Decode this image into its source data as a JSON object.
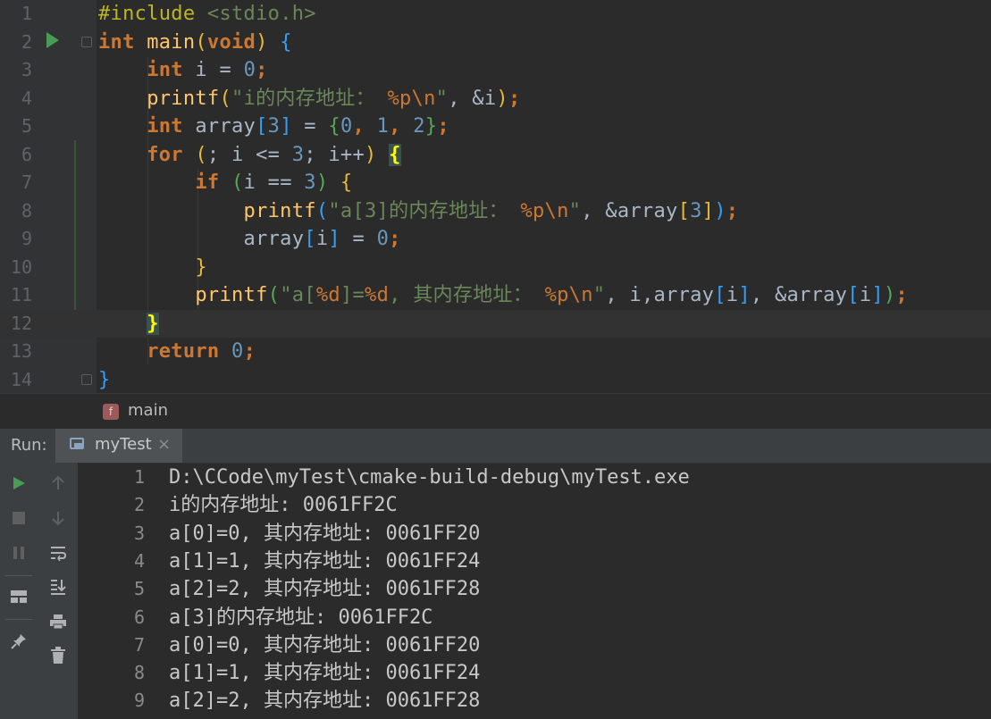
{
  "editor": {
    "line_numbers": [
      "1",
      "2",
      "3",
      "4",
      "5",
      "6",
      "7",
      "8",
      "9",
      "10",
      "11",
      "12",
      "13",
      "14"
    ],
    "l1": {
      "pp": "#include",
      "inc": " <stdio.h>"
    },
    "l2": {
      "kw": "int",
      "fn": "main",
      "p1": "(",
      "kw2": "void",
      "p2": ")",
      "p3": " {"
    },
    "l3": {
      "kw": "int",
      "t1": " i = ",
      "num": "0",
      "t2": ";"
    },
    "l4": {
      "fn": "printf",
      "p1": "(",
      "s1": "\"i",
      "cjk": "的内存地址：",
      "esc1": " %p\\n",
      "s2": "\"",
      "t1": ", &i",
      "p2": ")",
      "t2": ";"
    },
    "l5": {
      "kw": "int",
      "t1": " array",
      "b1": "[",
      "num1": "3",
      "b2": "]",
      "t2": " = ",
      "c1": "{",
      "num2": "0",
      "t3": ", ",
      "num3": "1",
      "t4": ", ",
      "num4": "2",
      "c2": "}",
      "t5": ";"
    },
    "l6": {
      "kw": "for",
      "p1": " (",
      "t1": "; i <= ",
      "num": "3",
      "t2": "; i++",
      "p2": ")",
      "br": "{"
    },
    "l7": {
      "kw": "if",
      "p1": " (",
      "t1": "i == ",
      "num": "3",
      "p2": ")",
      "br": " {"
    },
    "l8": {
      "fn": "printf",
      "p1": "(",
      "s1": "\"a[3]",
      "cjk": "的内存地址：",
      "esc1": " %p\\n",
      "s2": "\"",
      "t1": ", &array",
      "b1": "[",
      "num": "3",
      "b2": "]",
      "p2": ")",
      "t2": ";"
    },
    "l9": {
      "t1": "array",
      "b1": "[",
      "t2": "i",
      "b2": "]",
      "t3": " = ",
      "num": "0",
      "t4": ";"
    },
    "l10": {
      "br": "}"
    },
    "l11": {
      "fn": "printf",
      "p1": "(",
      "s1": "\"a[",
      "esc1": "%d",
      "s2": "]=",
      "esc2": "%d",
      "s3": ", ",
      "cjk": "其内存地址：",
      "esc3": " %p\\n",
      "s4": "\"",
      "t1": ", i,array",
      "b1": "[",
      "t2": "i",
      "b2": "]",
      "t3": ", &array",
      "b3": "[",
      "t4": "i",
      "b4": "]",
      "p2": ")",
      "t5": ";"
    },
    "l12": {
      "br": "}"
    },
    "l13": {
      "kw": "return",
      "t1": " ",
      "num": "0",
      "t2": ";"
    },
    "l14": {
      "br": "}"
    }
  },
  "breadcrumb": {
    "badge": "f",
    "name": "main"
  },
  "run_panel": {
    "label": "Run:",
    "tab_name": "myTest",
    "tab_close": "×",
    "toolbar_icons": [
      "rerun-icon",
      "stop-icon",
      "pause-icon",
      "layout-icon",
      "pin-icon",
      "up-arrow-icon",
      "down-arrow-icon",
      "soft-wrap-icon",
      "scroll-to-end-icon",
      "print-icon",
      "trash-icon"
    ]
  },
  "console": {
    "lines": [
      {
        "n": "1",
        "text": "D:\\CCode\\myTest\\cmake-build-debug\\myTest.exe"
      },
      {
        "n": "2",
        "text": "i的内存地址: 0061FF2C"
      },
      {
        "n": "3",
        "text": "a[0]=0, 其内存地址: 0061FF20"
      },
      {
        "n": "4",
        "text": "a[1]=1, 其内存地址: 0061FF24"
      },
      {
        "n": "5",
        "text": "a[2]=2, 其内存地址: 0061FF28"
      },
      {
        "n": "6",
        "text": "a[3]的内存地址: 0061FF2C"
      },
      {
        "n": "7",
        "text": "a[0]=0, 其内存地址: 0061FF20"
      },
      {
        "n": "8",
        "text": "a[1]=1, 其内存地址: 0061FF24"
      },
      {
        "n": "9",
        "text": "a[2]=2, 其内存地址: 0061FF28"
      }
    ]
  },
  "colors": {
    "background": "#2b2b2b",
    "keyword": "#cc7832",
    "string": "#6a8759",
    "number": "#6897bb",
    "function": "#ffc66d",
    "run_green": "#499c54"
  }
}
